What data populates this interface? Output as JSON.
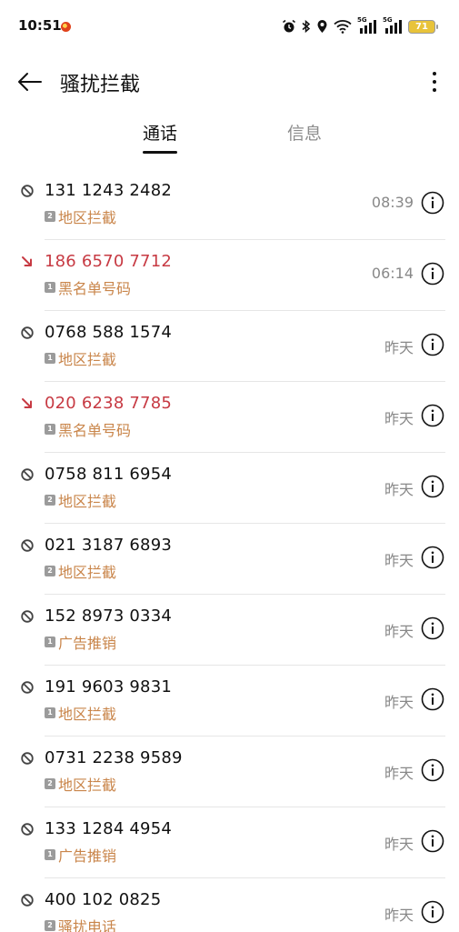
{
  "status_bar": {
    "time": "10:51",
    "network_label_1": "5G",
    "network_label_2": "5G",
    "battery": "71",
    "battery_color": "#e8c33a"
  },
  "header": {
    "title": "骚扰拦截",
    "back_icon": "arrow-left-icon",
    "more_icon": "more-vertical-icon"
  },
  "tabs": [
    {
      "label": "通话",
      "active": true
    },
    {
      "label": "信息",
      "active": false
    }
  ],
  "colors": {
    "missed_number": "#c73a43",
    "tag_text": "#c9854a",
    "secondary_text": "#888888"
  },
  "calls": [
    {
      "number": "131 1243 2482",
      "sim": "2",
      "tag": "地区拦截",
      "time": "08:39",
      "type": "blocked"
    },
    {
      "number": "186 6570 7712",
      "sim": "1",
      "tag": "黑名单号码",
      "time": "06:14",
      "type": "missed"
    },
    {
      "number": "0768 588 1574",
      "sim": "1",
      "tag": "地区拦截",
      "time": "昨天",
      "type": "blocked"
    },
    {
      "number": "020 6238 7785",
      "sim": "1",
      "tag": "黑名单号码",
      "time": "昨天",
      "type": "missed"
    },
    {
      "number": "0758 811 6954",
      "sim": "2",
      "tag": "地区拦截",
      "time": "昨天",
      "type": "blocked"
    },
    {
      "number": "021 3187 6893",
      "sim": "2",
      "tag": "地区拦截",
      "time": "昨天",
      "type": "blocked"
    },
    {
      "number": "152 8973 0334",
      "sim": "1",
      "tag": "广告推销",
      "time": "昨天",
      "type": "blocked"
    },
    {
      "number": "191 9603 9831",
      "sim": "1",
      "tag": "地区拦截",
      "time": "昨天",
      "type": "blocked"
    },
    {
      "number": "0731 2238 9589",
      "sim": "2",
      "tag": "地区拦截",
      "time": "昨天",
      "type": "blocked"
    },
    {
      "number": "133 1284 4954",
      "sim": "1",
      "tag": "广告推销",
      "time": "昨天",
      "type": "blocked"
    },
    {
      "number": "400 102 0825",
      "sim": "2",
      "tag": "骚扰电话",
      "time": "昨天",
      "type": "blocked"
    }
  ]
}
